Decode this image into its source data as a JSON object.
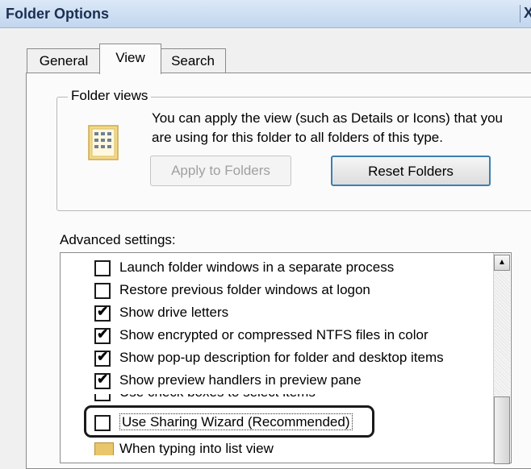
{
  "window": {
    "title": "Folder Options",
    "close_label": "X"
  },
  "tabs": [
    {
      "label": "General",
      "selected": false
    },
    {
      "label": "View",
      "selected": true
    },
    {
      "label": "Search",
      "selected": false
    }
  ],
  "folder_views": {
    "legend": "Folder views",
    "description": "You can apply the view (such as Details or Icons) that you are using for this folder to all folders of this type.",
    "apply_button": "Apply to Folders",
    "reset_button": "Reset Folders"
  },
  "advanced": {
    "label": "Advanced settings:",
    "options": [
      {
        "label": "Launch folder windows in a separate process",
        "checked": false
      },
      {
        "label": "Restore previous folder windows at logon",
        "checked": false
      },
      {
        "label": "Show drive letters",
        "checked": true
      },
      {
        "label": "Show encrypted or compressed NTFS files in color",
        "checked": true
      },
      {
        "label": "Show pop-up description for folder and desktop items",
        "checked": true
      },
      {
        "label": "Show preview handlers in preview pane",
        "checked": true
      },
      {
        "label": "Use check boxes to select items",
        "checked": false
      },
      {
        "label": "Use Sharing Wizard (Recommended)",
        "checked": false
      },
      {
        "label": "When typing into list view",
        "checked": null
      }
    ]
  },
  "icons": {
    "folder": "folder-view-icon",
    "scroll_up": "scroll-up-arrow-icon",
    "checkmark": "✔"
  },
  "colors": {
    "title_text": "#1b2f53",
    "highlight_border": "#1a1a1a"
  }
}
